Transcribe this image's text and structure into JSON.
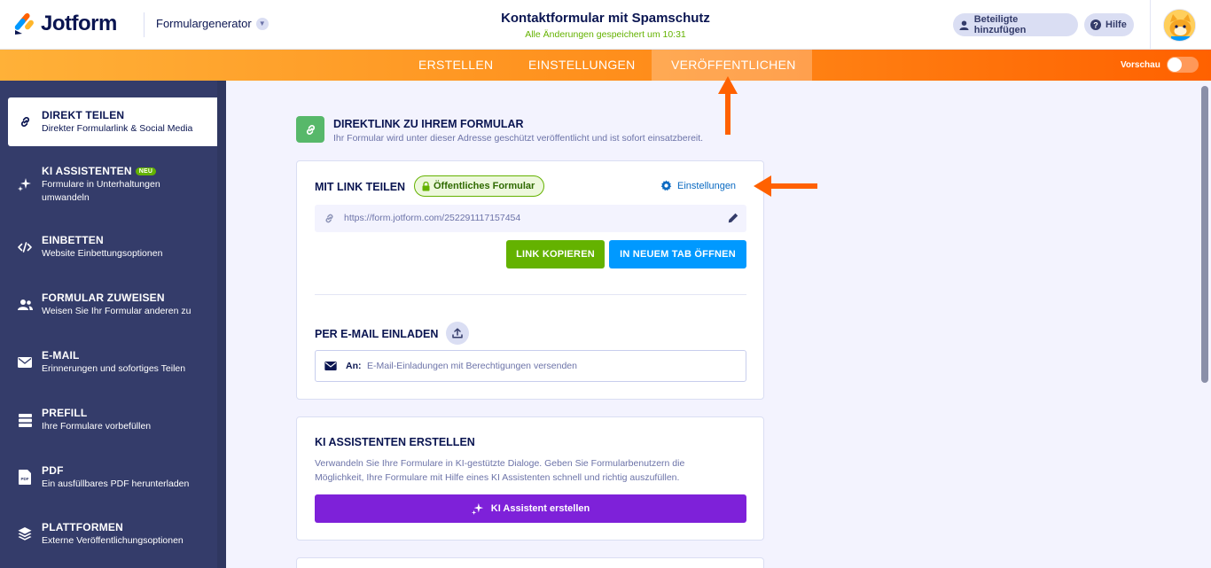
{
  "header": {
    "logo_text": "Jotform",
    "builder_label": "Formulargenerator",
    "form_title": "Kontaktformular mit Spamschutz",
    "saved_status": "Alle Änderungen gespeichert um 10:31",
    "collaborators_button": "Beteiligte hinzufügen",
    "help_button": "Hilfe",
    "avatar_icon": "cat-avatar-icon"
  },
  "nav": {
    "tabs": [
      {
        "label": "ERSTELLEN",
        "active": false
      },
      {
        "label": "EINSTELLUNGEN",
        "active": false
      },
      {
        "label": "VERÖFFENTLICHEN",
        "active": true
      }
    ],
    "preview_label": "Vorschau",
    "preview_on": false
  },
  "sidebar": {
    "items": [
      {
        "title": "DIREKT TEILEN",
        "desc": "Direkter Formularlink & Social Media",
        "icon": "link-icon",
        "active": true
      },
      {
        "title": "KI ASSISTENTEN",
        "badge": "NEU",
        "desc": "Formulare in Unterhaltungen umwandeln",
        "icon": "sparkle-icon"
      },
      {
        "title": "EINBETTEN",
        "desc": "Website Einbettungsoptionen",
        "icon": "code-icon"
      },
      {
        "title": "FORMULAR ZUWEISEN",
        "desc": "Weisen Sie Ihr Formular anderen zu",
        "icon": "users-icon"
      },
      {
        "title": "E-MAIL",
        "desc": "Erinnerungen und sofortiges Teilen",
        "icon": "envelope-icon"
      },
      {
        "title": "PREFILL",
        "desc": "Ihre Formulare vorbefüllen",
        "icon": "prefill-icon"
      },
      {
        "title": "PDF",
        "desc": "Ein ausfüllbares PDF herunterladen",
        "icon": "pdf-icon"
      },
      {
        "title": "PLATTFORMEN",
        "desc": "Externe Veröffentlichungsoptionen",
        "icon": "layers-icon"
      }
    ]
  },
  "main": {
    "section_title": "DIREKTLINK ZU IHREM FORMULAR",
    "section_sub": "Ihr Formular wird unter dieser Adresse geschützt veröffentlicht und ist sofort einsatzbereit.",
    "share": {
      "title": "MIT LINK TEILEN",
      "badge": "Öffentliches Formular",
      "settings_link": "Einstellungen",
      "url": "https://form.jotform.com/252291117157454",
      "copy_button": "LINK KOPIEREN",
      "open_button": "IN NEUEM TAB ÖFFNEN"
    },
    "email": {
      "title": "PER E-MAIL EINLADEN",
      "to_label": "An:",
      "placeholder": "E-Mail-Einladungen mit Berechtigungen versenden"
    },
    "ai": {
      "title": "KI ASSISTENTEN ERSTELLEN",
      "desc": "Verwandeln Sie Ihre Formulare in KI-gestützte Dialoge. Geben Sie Formularbenutzern die Möglichkeit, Ihre Formulare mit Hilfe eines KI Assistenten schnell und richtig auszufüllen.",
      "button": "KI Assistent erstellen"
    }
  },
  "colors": {
    "accent_orange": "#ff6100",
    "green": "#64b200",
    "blue": "#0099ff",
    "purple": "#7e21d9",
    "sidebar": "#343c6a"
  }
}
